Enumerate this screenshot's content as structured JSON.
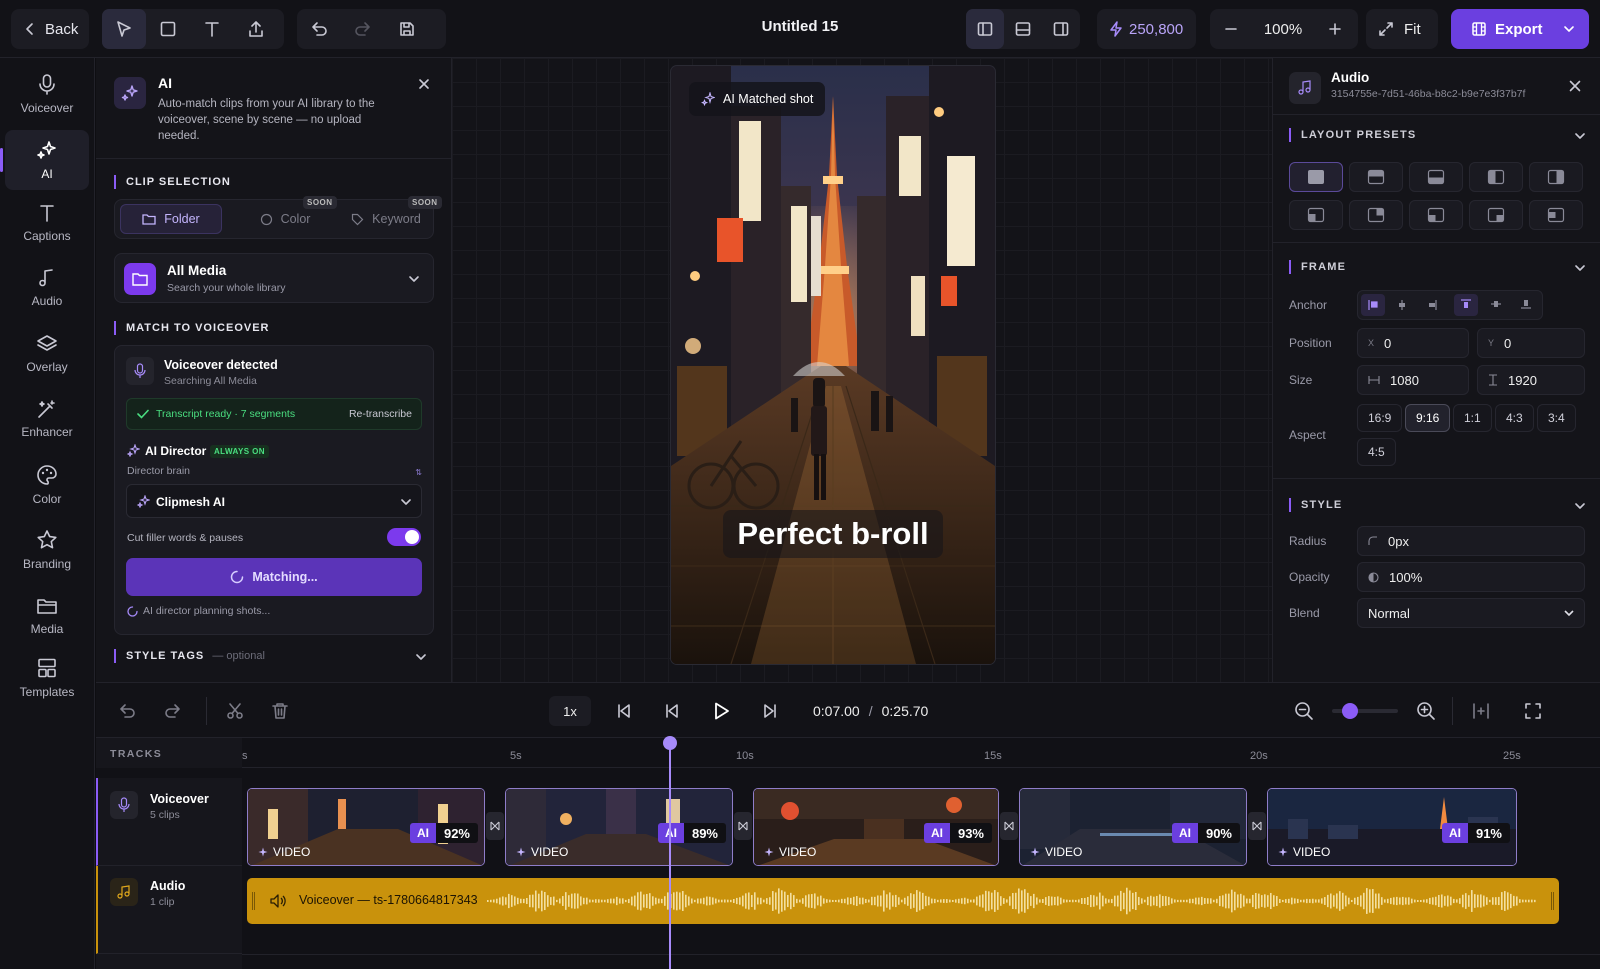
{
  "topbar": {
    "back_label": "Back",
    "title": "Untitled 15",
    "credits": "250,800",
    "zoom": "100%",
    "fit_label": "Fit",
    "export_label": "Export"
  },
  "rail": {
    "items": [
      {
        "label": "Voiceover",
        "icon": "mic-icon"
      },
      {
        "label": "AI",
        "icon": "sparkle-icon"
      },
      {
        "label": "Captions",
        "icon": "text-icon"
      },
      {
        "label": "Audio",
        "icon": "music-icon"
      },
      {
        "label": "Overlay",
        "icon": "layers-icon"
      },
      {
        "label": "Enhancer",
        "icon": "wand-icon"
      },
      {
        "label": "Color",
        "icon": "palette-icon"
      },
      {
        "label": "Branding",
        "icon": "star-icon"
      },
      {
        "label": "Media",
        "icon": "folder-icon"
      },
      {
        "label": "Templates",
        "icon": "templates-icon"
      }
    ]
  },
  "ai_panel": {
    "title": "AI",
    "description": "Auto-match clips from your AI library to the voiceover, scene by scene — no upload needed.",
    "clip_selection_title": "CLIP SELECTION",
    "tabs": [
      {
        "label": "Folder",
        "badge": ""
      },
      {
        "label": "Color",
        "badge": "SOON"
      },
      {
        "label": "Keyword",
        "badge": "SOON"
      }
    ],
    "media_title": "All Media",
    "media_subtitle": "Search your whole library",
    "match_title": "MATCH TO VOICEOVER",
    "voiceover_detected": "Voiceover detected",
    "voiceover_searching": "Searching All Media",
    "transcript_status": "Transcript ready · 7 segments",
    "retranscribe_label": "Re-transcribe",
    "director_label": "AI Director",
    "director_badge": "ALWAYS ON",
    "director_brain_label": "Director brain",
    "director_brain_value": "Clipmesh AI",
    "filler_label": "Cut filler words & pauses",
    "filler_on": true,
    "matching_label": "Matching...",
    "planning_label": "AI director planning shots...",
    "style_tags_title": "STYLE TAGS",
    "style_tags_optional": "— optional"
  },
  "preview": {
    "badge": "AI Matched shot",
    "caption": "Perfect b-roll"
  },
  "right_panel": {
    "title": "Audio",
    "id": "3154755e-7d51-46ba-b8c2-b9e7e3f37b7f",
    "layout_presets_title": "LAYOUT PRESETS",
    "frame_title": "FRAME",
    "anchor_label": "Anchor",
    "position_label": "Position",
    "pos_x_prefix": "X",
    "pos_x": "0",
    "pos_y_prefix": "Y",
    "pos_y": "0",
    "size_label": "Size",
    "size_w": "1080",
    "size_h": "1920",
    "aspect_label": "Aspect",
    "aspects": [
      "16:9",
      "9:16",
      "1:1",
      "4:3",
      "3:4",
      "4:5"
    ],
    "aspect_selected": "9:16",
    "style_title": "STYLE",
    "radius_label": "Radius",
    "radius_value": "0px",
    "opacity_label": "Opacity",
    "opacity_value": "100%",
    "blend_label": "Blend",
    "blend_value": "Normal"
  },
  "transport": {
    "speed": "1x",
    "current_time": "0:07.00",
    "separator": "/",
    "total_time": "0:25.70",
    "zoom_level": 0.2
  },
  "timeline": {
    "tracks_label": "TRACKS",
    "ruler": [
      "s",
      "5s",
      "10s",
      "15s",
      "20s",
      "25s"
    ],
    "voiceover_track": {
      "name": "Voiceover",
      "sub": "5 clips"
    },
    "audio_track": {
      "name": "Audio",
      "sub": "1 clip"
    },
    "clips": [
      {
        "tag": "VIDEO",
        "ai": "AI",
        "score": "92%"
      },
      {
        "tag": "VIDEO",
        "ai": "AI",
        "score": "89%"
      },
      {
        "tag": "VIDEO",
        "ai": "AI",
        "score": "93%"
      },
      {
        "tag": "VIDEO",
        "ai": "AI",
        "score": "90%"
      },
      {
        "tag": "VIDEO",
        "ai": "AI",
        "score": "91%"
      }
    ],
    "audio_clip_label": "Voiceover — ts-1780664817343"
  },
  "colors": {
    "accent": "#8b5cf6",
    "export": "#6b3fe0",
    "audio_clip": "#c9920c",
    "success": "#4ade80"
  }
}
